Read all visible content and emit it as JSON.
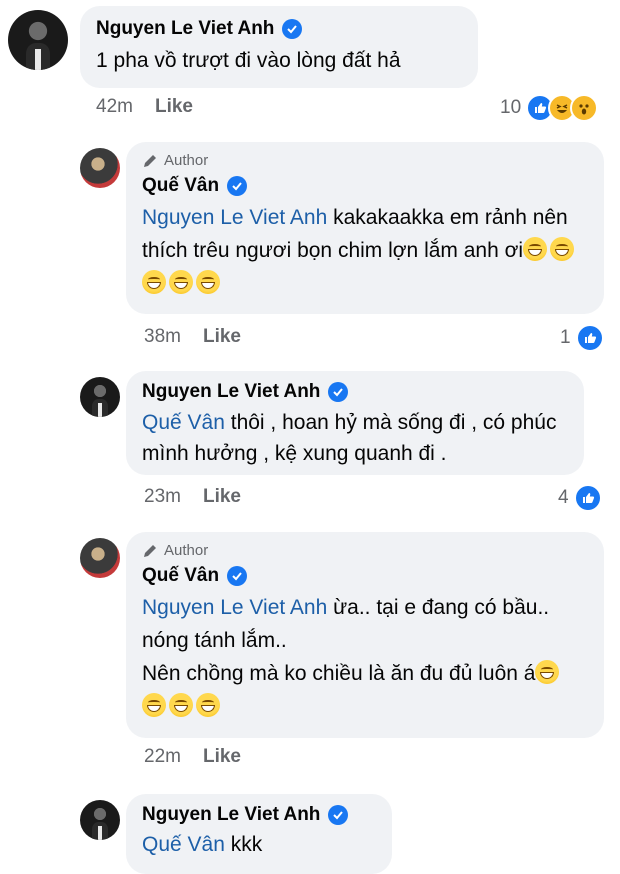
{
  "comments": [
    {
      "author": "Nguyen Le Viet Anh",
      "text": "1 pha vồ trượt đi vào lòng đất hả",
      "time": "42m",
      "like_label": "Like",
      "reaction_count": "10",
      "reactions": [
        "like-icon",
        "haha-icon",
        "wow-icon"
      ]
    },
    {
      "author_tag": "Author",
      "author": "Quế Vân",
      "mention": "Nguyen Le Viet Anh",
      "text": " kakakaakka em rảnh nên thích trêu ngươi bọn chim lợn lắm anh ơi",
      "emoji_count": 5,
      "time": "38m",
      "like_label": "Like",
      "reaction_count": "1"
    },
    {
      "author": "Nguyen Le Viet Anh",
      "mention": "Quế Vân",
      "text": " thôi , hoan hỷ mà sống đi , có phúc mình hưởng , kệ xung quanh đi .",
      "time": "23m",
      "like_label": "Like",
      "reaction_count": "4"
    },
    {
      "author_tag": "Author",
      "author": "Quế Vân",
      "mention": "Nguyen Le Viet Anh",
      "text": " ừa.. tại e đang có bầu.. nóng tánh lắm..",
      "text2": "Nên chồng mà ko chiều là ăn đu đủ luôn á",
      "emoji_count": 4,
      "time": "22m",
      "like_label": "Like"
    },
    {
      "author": "Nguyen Le Viet Anh",
      "mention": "Quế Vân",
      "text": " kkk"
    }
  ],
  "colors": {
    "bubble": "#f0f2f5",
    "mention": "#1d5fa8",
    "verified": "#1877f2",
    "meta": "#65676b"
  }
}
